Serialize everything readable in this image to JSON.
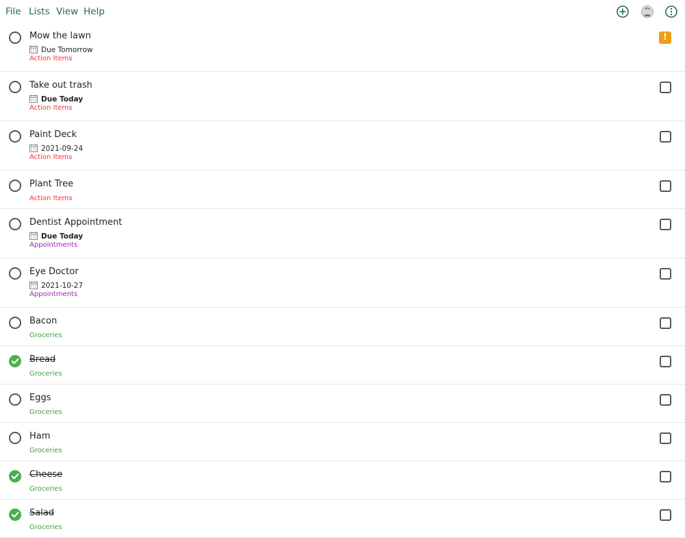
{
  "menu": {
    "file": "File",
    "lists": "Lists",
    "view": "View",
    "help": "Help"
  },
  "icons": {
    "add": "add-circle-icon",
    "avatar": "avatar-icon",
    "more": "more-options-icon"
  },
  "colors": {
    "accent": "#1f6b5d",
    "action_items": "#e53935",
    "appointments": "#9c27b0",
    "groceries": "#43a047",
    "done": "#4caf50",
    "priority": "#f39c12"
  },
  "tasks": [
    {
      "title": "Mow the lawn",
      "due": "Due Tomorrow",
      "category": "Action Items",
      "done": false,
      "priority": true,
      "flag": "!"
    },
    {
      "title": "Take out trash",
      "due": "Due Today",
      "category": "Action Items",
      "done": false,
      "priority": false
    },
    {
      "title": "Paint Deck",
      "due": "2021-09-24",
      "category": "Action Items",
      "done": false,
      "priority": false
    },
    {
      "title": "Plant Tree",
      "due": "",
      "category": "Action Items",
      "done": false,
      "priority": false
    },
    {
      "title": "Dentist Appointment",
      "due": "Due Today",
      "category": "Appointments",
      "done": false,
      "priority": false
    },
    {
      "title": "Eye Doctor",
      "due": "2021-10-27",
      "category": "Appointments",
      "done": false,
      "priority": false
    },
    {
      "title": "Bacon",
      "due": "",
      "category": "Groceries",
      "done": false,
      "priority": false
    },
    {
      "title": "Bread",
      "due": "",
      "category": "Groceries",
      "done": true,
      "priority": false
    },
    {
      "title": "Eggs",
      "due": "",
      "category": "Groceries",
      "done": false,
      "priority": false
    },
    {
      "title": "Ham",
      "due": "",
      "category": "Groceries",
      "done": false,
      "priority": false
    },
    {
      "title": "Cheese",
      "due": "",
      "category": "Groceries",
      "done": true,
      "priority": false
    },
    {
      "title": "Salad",
      "due": "",
      "category": "Groceries",
      "done": true,
      "priority": false
    }
  ]
}
